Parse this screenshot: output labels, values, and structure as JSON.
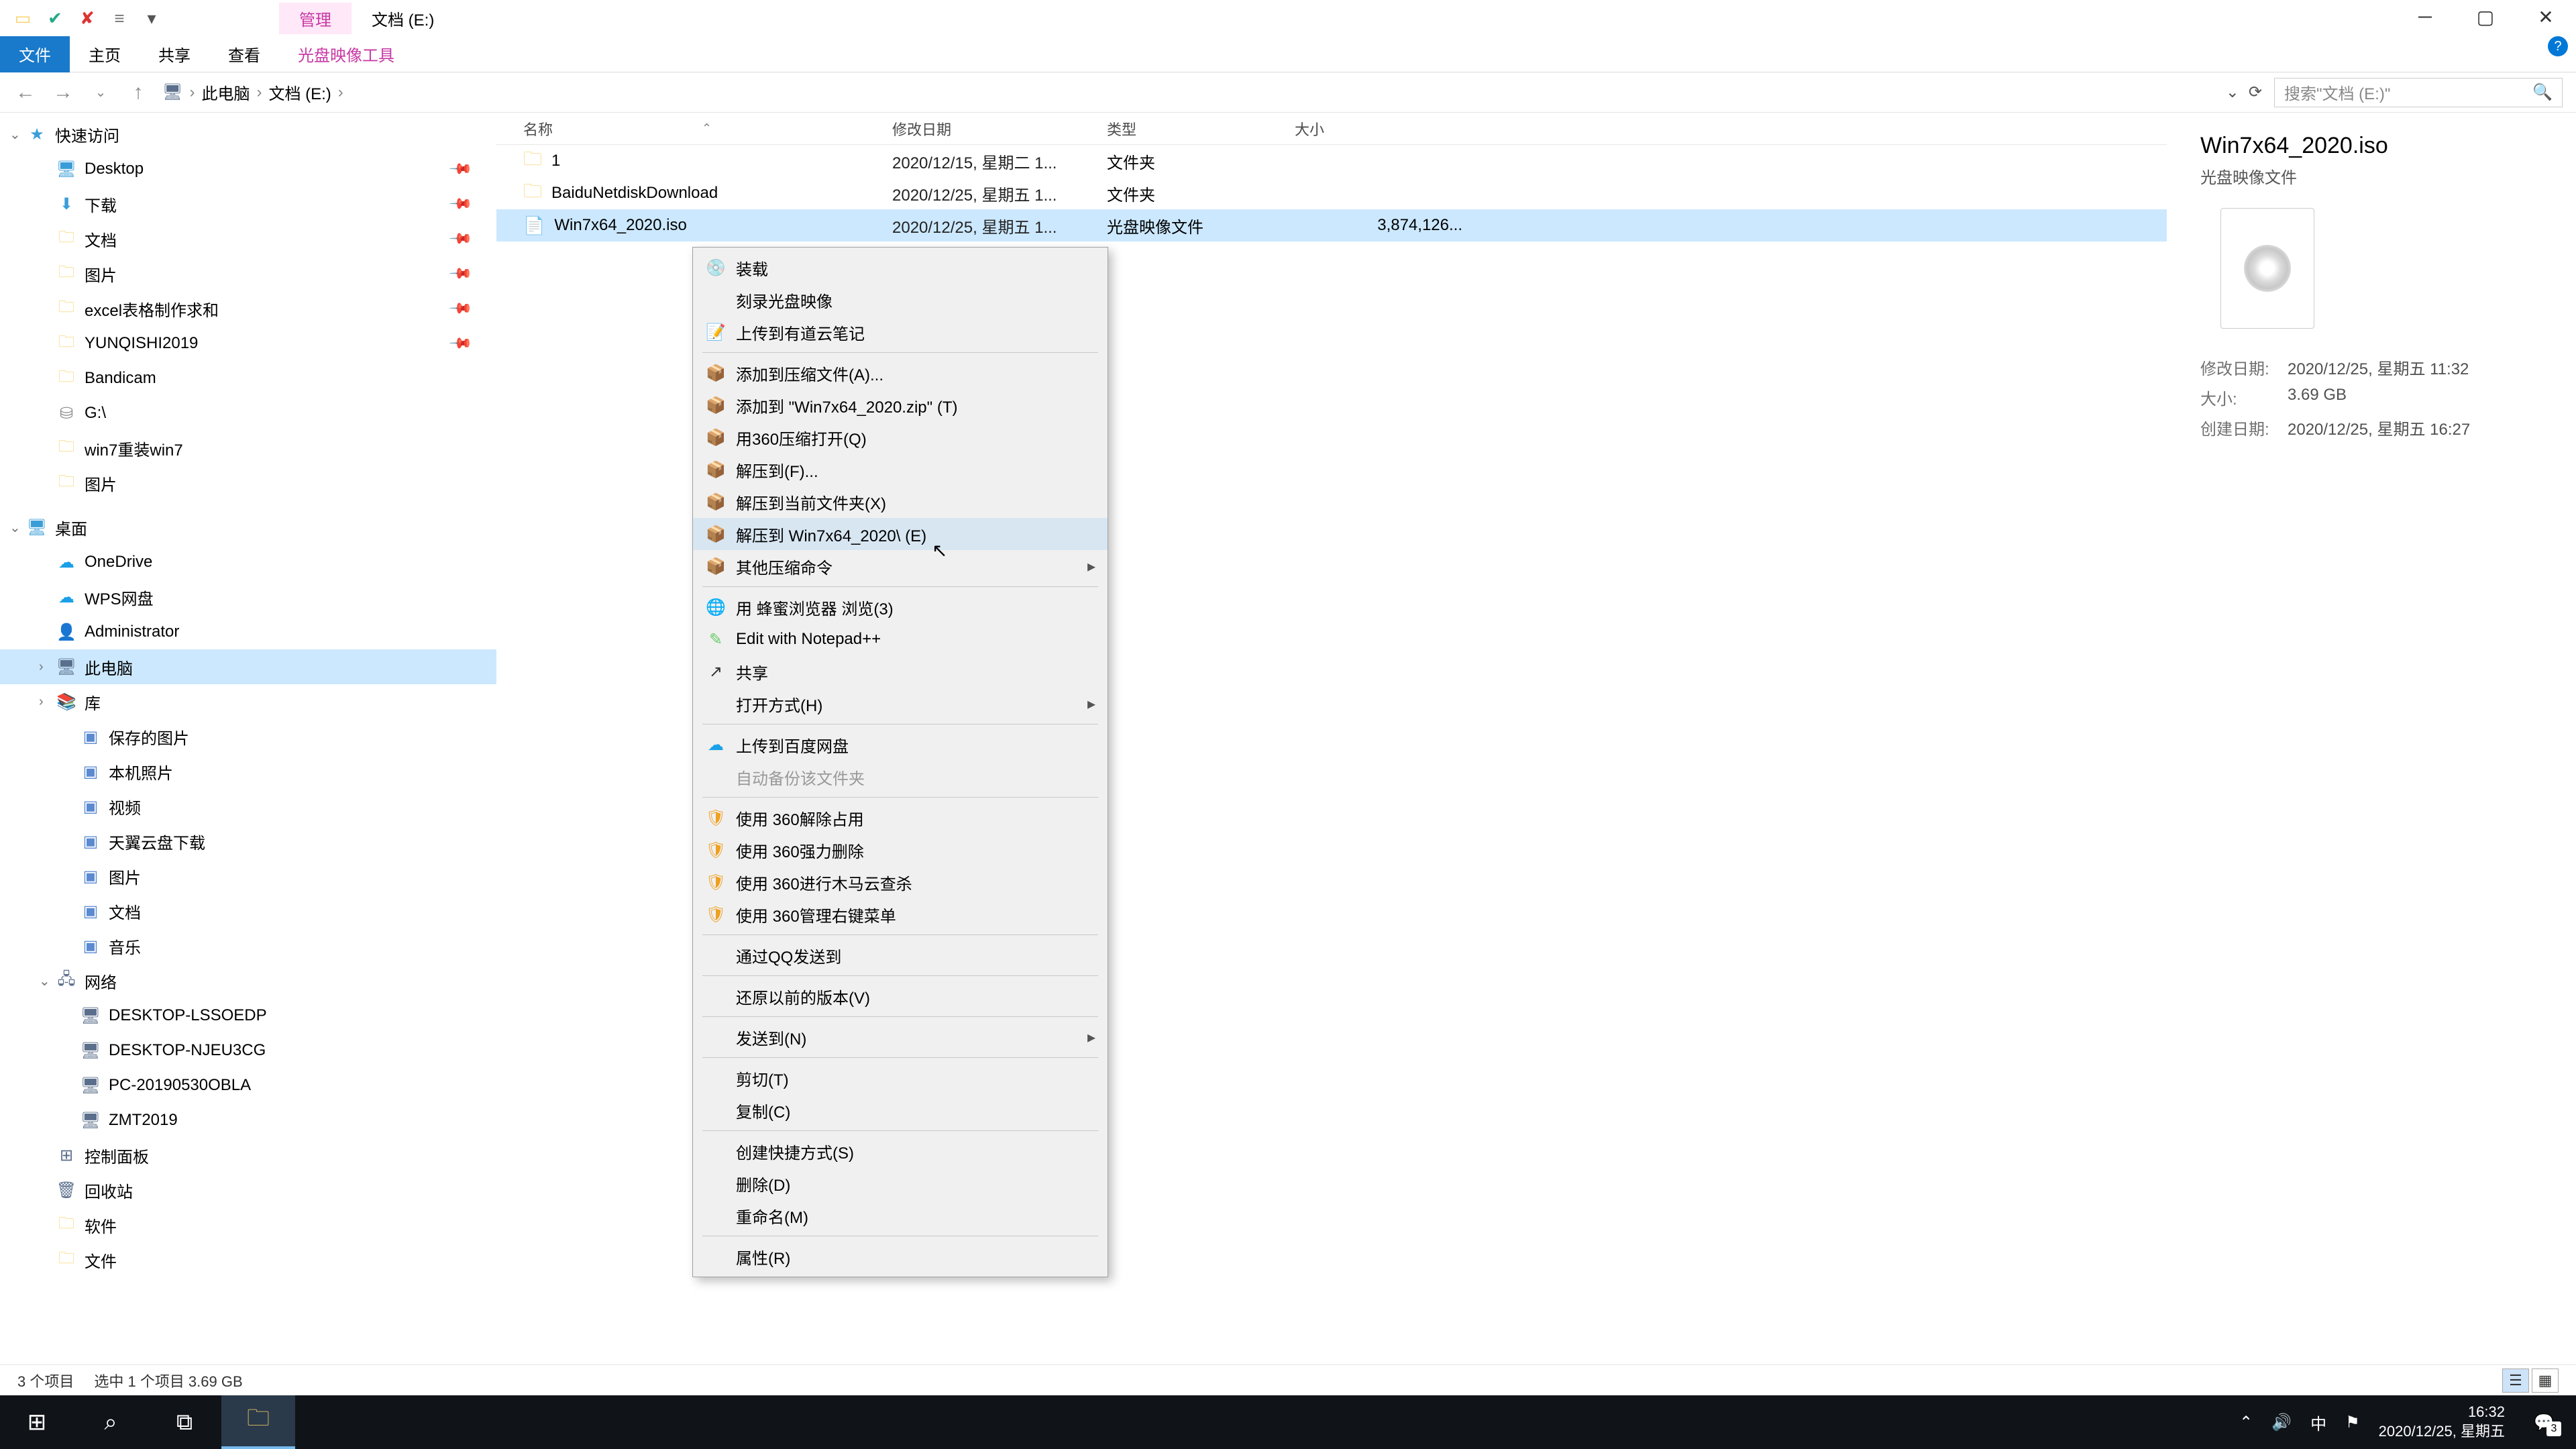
{
  "titlebar": {
    "qat_icons": [
      "folder-icon",
      "check-icon",
      "x-icon",
      "eq-icon",
      "dropdown-icon"
    ],
    "tab_manage": "管理",
    "title": "文档 (E:)"
  },
  "ribbon": {
    "file": "文件",
    "home": "主页",
    "share": "共享",
    "view": "查看",
    "disc_tools": "光盘映像工具"
  },
  "addr": {
    "this_pc": "此电脑",
    "drive": "文档 (E:)",
    "refresh": "⟳",
    "search_placeholder": "搜索\"文档 (E:)\""
  },
  "sidebar": {
    "quick_access": "快速访问",
    "items_qa": [
      {
        "icon": "desktop",
        "label": "Desktop",
        "pin": true
      },
      {
        "icon": "dl",
        "label": "下载",
        "pin": true
      },
      {
        "icon": "folder",
        "label": "文档",
        "pin": true
      },
      {
        "icon": "folder",
        "label": "图片",
        "pin": true
      },
      {
        "icon": "folder",
        "label": "excel表格制作求和",
        "pin": true
      },
      {
        "icon": "folder",
        "label": "YUNQISHI2019",
        "pin": true
      },
      {
        "icon": "folder",
        "label": "Bandicam"
      },
      {
        "icon": "disk",
        "label": "G:\\"
      },
      {
        "icon": "folder",
        "label": "win7重装win7"
      },
      {
        "icon": "folder",
        "label": "图片"
      }
    ],
    "desktop": "桌面",
    "items_desk": [
      {
        "icon": "cloud",
        "label": "OneDrive"
      },
      {
        "icon": "cloud",
        "label": "WPS网盘"
      },
      {
        "icon": "user",
        "label": "Administrator"
      },
      {
        "icon": "pc",
        "label": "此电脑",
        "sel": true
      },
      {
        "icon": "lib",
        "label": "库"
      }
    ],
    "items_lib": [
      {
        "label": "保存的图片"
      },
      {
        "label": "本机照片"
      },
      {
        "label": "视频"
      },
      {
        "label": "天翼云盘下载"
      },
      {
        "label": "图片"
      },
      {
        "label": "文档"
      },
      {
        "label": "音乐"
      }
    ],
    "network": "网络",
    "items_net": [
      {
        "label": "DESKTOP-LSSOEDP"
      },
      {
        "label": "DESKTOP-NJEU3CG"
      },
      {
        "label": "PC-20190530OBLA"
      },
      {
        "label": "ZMT2019"
      }
    ],
    "control_panel": "控制面板",
    "recycle": "回收站",
    "soft": "软件",
    "doc_folder": "文件"
  },
  "cols": {
    "name": "名称",
    "date": "修改日期",
    "type": "类型",
    "size": "大小"
  },
  "files": [
    {
      "icon": "folder",
      "name": "1",
      "date": "2020/12/15, 星期二 1...",
      "type": "文件夹",
      "size": ""
    },
    {
      "icon": "folder",
      "name": "BaiduNetdiskDownload",
      "date": "2020/12/25, 星期五 1...",
      "type": "文件夹",
      "size": ""
    },
    {
      "icon": "iso",
      "name": "Win7x64_2020.iso",
      "date": "2020/12/25, 星期五 1...",
      "type": "光盘映像文件",
      "size": "3,874,126...",
      "sel": true
    }
  ],
  "ctx": {
    "groups": [
      [
        {
          "icon": "mount",
          "label": "装载"
        },
        {
          "label": "刻录光盘映像"
        },
        {
          "icon": "note",
          "label": "上传到有道云笔记"
        }
      ],
      [
        {
          "icon": "zip",
          "label": "添加到压缩文件(A)..."
        },
        {
          "icon": "zip",
          "label": "添加到 \"Win7x64_2020.zip\" (T)"
        },
        {
          "icon": "zip",
          "label": "用360压缩打开(Q)"
        },
        {
          "icon": "zip",
          "label": "解压到(F)..."
        },
        {
          "icon": "zip",
          "label": "解压到当前文件夹(X)"
        },
        {
          "icon": "zip",
          "label": "解压到 Win7x64_2020\\ (E)",
          "hov": true
        },
        {
          "icon": "zip",
          "label": "其他压缩命令",
          "arrow": true
        }
      ],
      [
        {
          "icon": "browse",
          "label": "用 蜂蜜浏览器 浏览(3)"
        },
        {
          "icon": "edit",
          "label": "Edit with Notepad++"
        },
        {
          "icon": "share",
          "label": "共享"
        },
        {
          "label": "打开方式(H)",
          "arrow": true
        }
      ],
      [
        {
          "icon": "cloud",
          "label": "上传到百度网盘"
        },
        {
          "label": "自动备份该文件夹",
          "dis": true
        }
      ],
      [
        {
          "icon": "360",
          "label": "使用 360解除占用"
        },
        {
          "icon": "360",
          "label": "使用 360强力删除"
        },
        {
          "icon": "360",
          "label": "使用 360进行木马云查杀"
        },
        {
          "icon": "360",
          "label": "使用 360管理右键菜单"
        }
      ],
      [
        {
          "label": "通过QQ发送到"
        }
      ],
      [
        {
          "label": "还原以前的版本(V)"
        }
      ],
      [
        {
          "label": "发送到(N)",
          "arrow": true
        }
      ],
      [
        {
          "label": "剪切(T)"
        },
        {
          "label": "复制(C)"
        }
      ],
      [
        {
          "label": "创建快捷方式(S)"
        },
        {
          "label": "删除(D)"
        },
        {
          "label": "重命名(M)"
        }
      ],
      [
        {
          "label": "属性(R)"
        }
      ]
    ]
  },
  "details": {
    "title": "Win7x64_2020.iso",
    "subtype": "光盘映像文件",
    "rows": [
      {
        "label": "修改日期:",
        "val": "2020/12/25, 星期五 11:32"
      },
      {
        "label": "大小:",
        "val": "3.69 GB"
      },
      {
        "label": "创建日期:",
        "val": "2020/12/25, 星期五 16:27"
      }
    ]
  },
  "status": {
    "count": "3 个项目",
    "selection": "选中 1 个项目  3.69 GB"
  },
  "taskbar": {
    "time": "16:32",
    "date": "2020/12/25, 星期五",
    "ime": "中",
    "badge": "3"
  }
}
